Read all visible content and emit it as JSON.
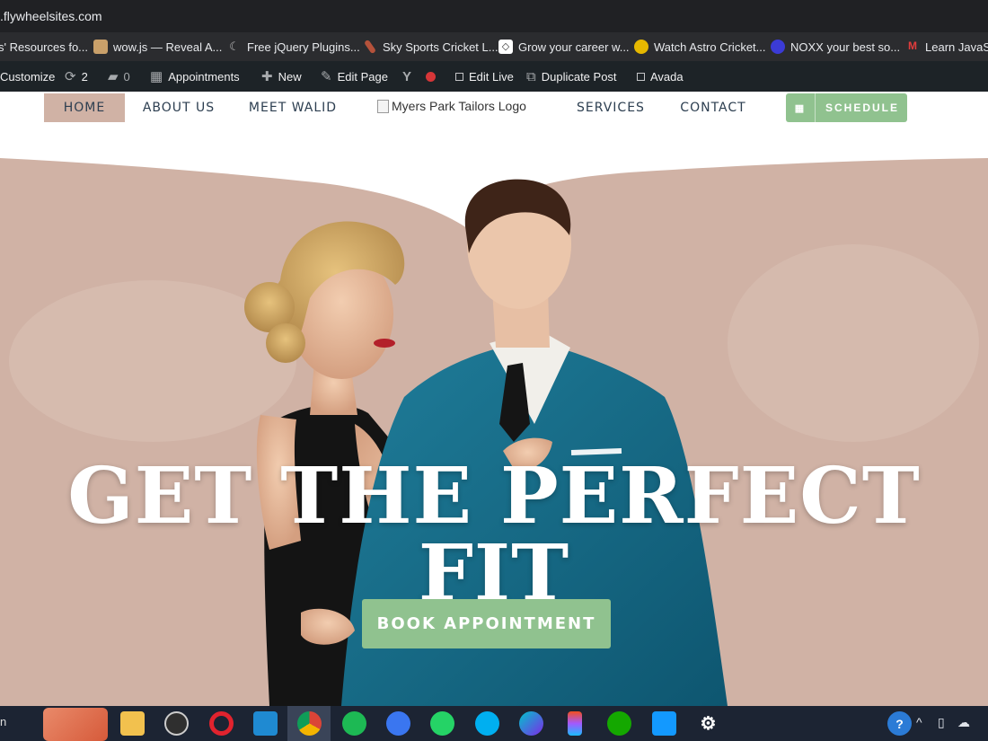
{
  "browser": {
    "url": ".flywheelsites.com",
    "bookmarks": [
      {
        "label": "s' Resources fo...",
        "icon": "bookmark-resources-icon"
      },
      {
        "label": "wow.js — Reveal A...",
        "icon": "wowjs-favicon-icon"
      },
      {
        "label": "Free jQuery Plugins...",
        "icon": "jquery-favicon-icon"
      },
      {
        "label": "Sky Sports Cricket L...",
        "icon": "cricket-bat-icon"
      },
      {
        "label": "Grow your career w...",
        "icon": "diamond-favicon-icon"
      },
      {
        "label": "Watch Astro Cricket...",
        "icon": "astro-favicon-icon"
      },
      {
        "label": "NOXX your best so...",
        "icon": "noxx-favicon-icon"
      },
      {
        "label": "Learn JavaScr",
        "icon": "m-favicon-icon"
      }
    ]
  },
  "wp_admin": {
    "customize": "Customize",
    "updates_count": "2",
    "comments_count": "0",
    "appointments": "Appointments",
    "new": "New",
    "edit_page": "Edit Page",
    "edit_live": "Edit Live",
    "duplicate_post": "Duplicate Post",
    "avada": "Avada"
  },
  "site_nav": {
    "home": "HOME",
    "about": "ABOUT US",
    "meet": "MEET WALID",
    "logo_alt": "Myers Park Tailors Logo",
    "services": "SERVICES",
    "contact": "CONTACT",
    "schedule": "SCHEDULE"
  },
  "hero": {
    "headline": "GET THE PERFECT FIT",
    "cta": "BOOK APPOINTMENT"
  },
  "colors": {
    "accent_green": "#90c28f",
    "hero_bg": "#d0b2a5",
    "nav_text": "#2c3e50"
  },
  "taskbar": {
    "apps": [
      "file-explorer",
      "obs",
      "opera",
      "vscode",
      "chrome",
      "spotify",
      "signal",
      "whatsapp",
      "skype",
      "canva",
      "figma",
      "upwork",
      "prime-video",
      "settings"
    ]
  }
}
